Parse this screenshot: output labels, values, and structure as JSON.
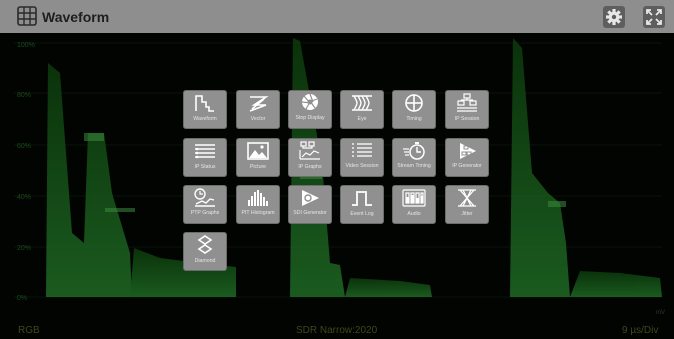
{
  "window": {
    "title": "Waveform",
    "title_icon": "grid-icon",
    "buttons": [
      {
        "name": "settings",
        "icon": "gear-icon"
      },
      {
        "name": "fullscreen",
        "icon": "fullscreen-icon"
      }
    ]
  },
  "graticule": [
    "100%",
    "80%",
    "60%",
    "40%",
    "20%",
    "0%"
  ],
  "graticule_right": "mV",
  "status_bar": {
    "left": "RGB",
    "center": "SDR Narrow:2020",
    "right": "9 µs/Div"
  },
  "menu": {
    "tiles": [
      {
        "id": "waveform",
        "label": "Waveform",
        "icon": "waveform-icon"
      },
      {
        "id": "vector",
        "label": "Vector",
        "icon": "vector-icon"
      },
      {
        "id": "stop-display",
        "label": "Stop Display",
        "icon": "aperture-icon"
      },
      {
        "id": "eye",
        "label": "Eye",
        "icon": "eye-pattern-icon"
      },
      {
        "id": "timing",
        "label": "Timing",
        "icon": "crosshair-icon"
      },
      {
        "id": "ip-session",
        "label": "IP Session",
        "icon": "ip-session-icon"
      },
      {
        "id": "ip-status",
        "label": "IP Status",
        "icon": "ip-status-icon"
      },
      {
        "id": "picture",
        "label": "Picture",
        "icon": "picture-icon"
      },
      {
        "id": "ip-graphs",
        "label": "IP Graphs",
        "icon": "ip-graphs-icon"
      },
      {
        "id": "video-session",
        "label": "Video Session",
        "icon": "video-session-icon"
      },
      {
        "id": "stream-timing",
        "label": "Stream Timing",
        "icon": "stream-timing-icon"
      },
      {
        "id": "ip-generator",
        "label": "IP Generator",
        "icon": "ip-generator-icon"
      },
      {
        "id": "ptp-graphs",
        "label": "PTP Graphs",
        "icon": "ptp-graphs-icon"
      },
      {
        "id": "pit-histogram",
        "label": "PIT Histogram",
        "icon": "histogram-icon"
      },
      {
        "id": "sdi-generator",
        "label": "SDI Generator",
        "icon": "sdi-generator-icon"
      },
      {
        "id": "event-log",
        "label": "Event Log",
        "icon": "pulse-icon"
      },
      {
        "id": "audio",
        "label": "Audio",
        "icon": "audio-meter-icon"
      },
      {
        "id": "jitter",
        "label": "Jitter",
        "icon": "jitter-icon"
      },
      {
        "id": "diamond",
        "label": "Diamond",
        "icon": "diamond-icon"
      }
    ]
  }
}
